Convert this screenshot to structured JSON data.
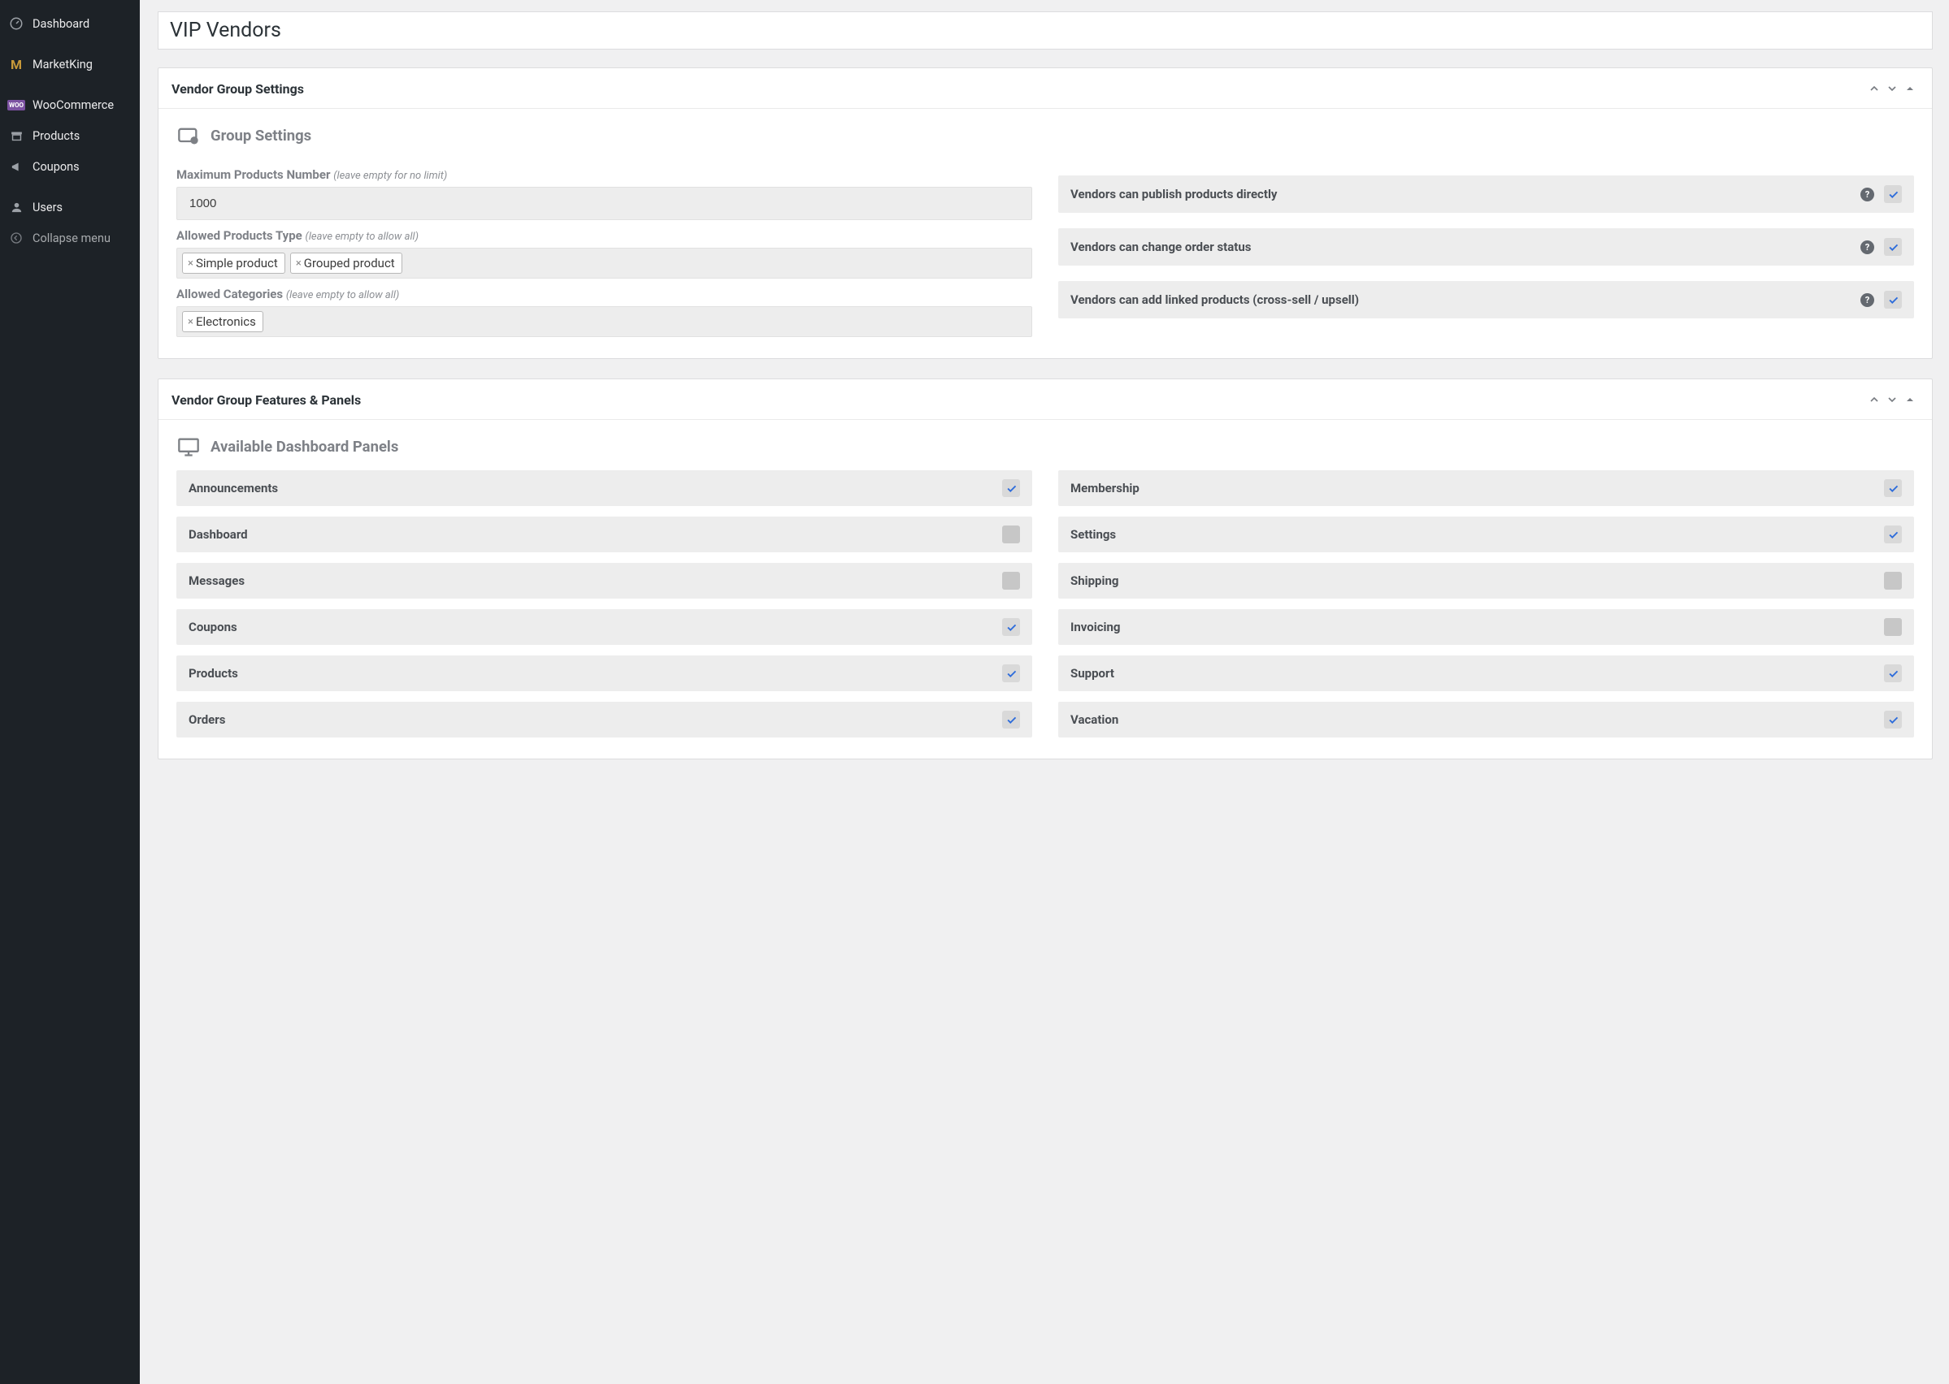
{
  "sidebar": {
    "items": [
      {
        "icon": "dash",
        "label": "Dashboard"
      },
      {
        "icon": "mk",
        "label": "MarketKing"
      },
      {
        "icon": "woo",
        "label": "WooCommerce"
      },
      {
        "icon": "prod",
        "label": "Products"
      },
      {
        "icon": "coup",
        "label": "Coupons"
      },
      {
        "icon": "user",
        "label": "Users"
      },
      {
        "icon": "coll",
        "label": "Collapse menu"
      }
    ]
  },
  "page_title": "VIP Vendors",
  "panel1": {
    "title": "Vendor Group Settings",
    "heading": "Group Settings",
    "max_products": {
      "label": "Maximum Products Number",
      "hint": "(leave empty for no limit)",
      "value": "1000"
    },
    "allowed_types": {
      "label": "Allowed Products Type",
      "hint": "(leave empty to allow all)",
      "tags": [
        "Simple product",
        "Grouped product"
      ]
    },
    "allowed_cats": {
      "label": "Allowed Categories",
      "hint": "(leave empty to allow all)",
      "tags": [
        "Electronics"
      ]
    },
    "toggles": [
      {
        "label": "Vendors can publish products directly",
        "on": true
      },
      {
        "label": "Vendors can change order status",
        "on": true
      },
      {
        "label": "Vendors can add linked products (cross-sell / upsell)",
        "on": true
      }
    ]
  },
  "panel2": {
    "title": "Vendor Group Features & Panels",
    "heading": "Available Dashboard Panels",
    "left": [
      {
        "label": "Announcements",
        "on": true
      },
      {
        "label": "Dashboard",
        "on": false
      },
      {
        "label": "Messages",
        "on": false
      },
      {
        "label": "Coupons",
        "on": true
      },
      {
        "label": "Products",
        "on": true
      },
      {
        "label": "Orders",
        "on": true
      }
    ],
    "right": [
      {
        "label": "Membership",
        "on": true
      },
      {
        "label": "Settings",
        "on": true
      },
      {
        "label": "Shipping",
        "on": false
      },
      {
        "label": "Invoicing",
        "on": false
      },
      {
        "label": "Support",
        "on": true
      },
      {
        "label": "Vacation",
        "on": true
      }
    ]
  }
}
